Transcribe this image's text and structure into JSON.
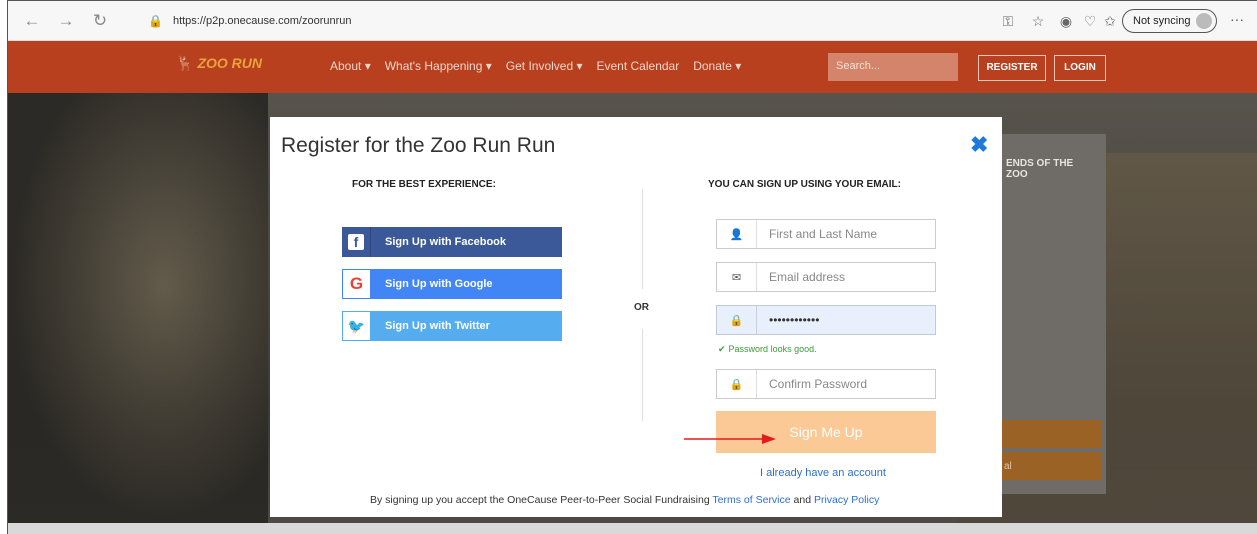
{
  "browser": {
    "url": "https://p2p.onecause.com/zoorunrun",
    "sync_label": "Not syncing",
    "more": "···"
  },
  "site": {
    "logo_text": "ZOO RUN",
    "menu": [
      "About ▾",
      "What's Happening ▾",
      "Get Involved ▾",
      "Event Calendar",
      "Donate ▾"
    ],
    "search_placeholder": "Search...",
    "register_label": "REGISTER",
    "login_label": "LOGIN"
  },
  "side_card": {
    "text_line1": "ENDS OF THE",
    "text_line2": "ZOO",
    "button2_text": "al"
  },
  "modal": {
    "title": "Register for the Zoo Run Run",
    "left_heading": "FOR THE BEST EXPERIENCE:",
    "right_heading": "YOU CAN SIGN UP USING YOUR EMAIL:",
    "or_label": "OR",
    "facebook_label": "Sign Up with Facebook",
    "google_label": "Sign Up with Google",
    "twitter_label": "Sign Up with Twitter",
    "name_placeholder": "First and Last Name",
    "email_placeholder": "Email address",
    "password_value": "••••••••••••",
    "password_status": "Password looks good.",
    "confirm_placeholder": "Confirm Password",
    "submit_label": "Sign Me Up",
    "login_link": "I already have an account",
    "terms_prefix": "By signing up you accept the OneCause Peer-to-Peer Social Fundraising ",
    "terms_link": "Terms of Service",
    "terms_and": " and ",
    "privacy_link": "Privacy Policy"
  },
  "colors": {
    "site_nav": "#b8401e",
    "facebook": "#3b5998",
    "google": "#4285f4",
    "twitter": "#55acee",
    "submit": "#fbc995",
    "link": "#2b6fd1",
    "annotation_arrow": "#e31b1b"
  }
}
